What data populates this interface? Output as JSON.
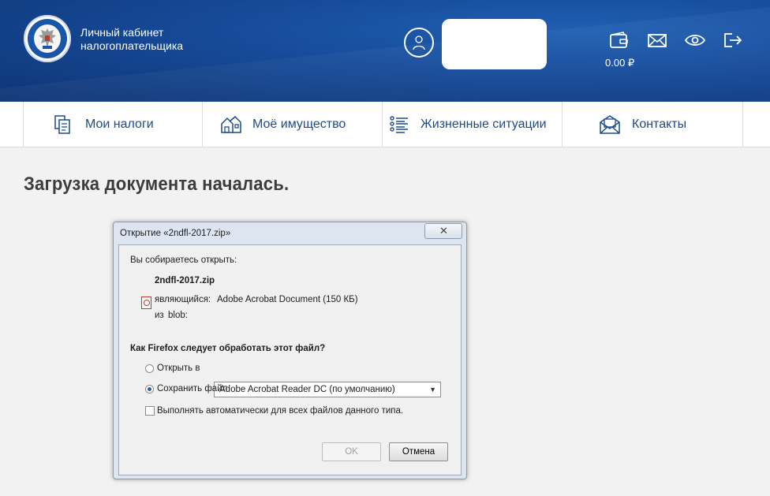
{
  "header": {
    "brand_line1": "Личный кабинет",
    "brand_line2": "налогоплательщика",
    "balance": "0.00 ₽",
    "icons": [
      "wallet-icon",
      "mail-icon",
      "eye-icon",
      "logout-icon"
    ]
  },
  "nav": {
    "items": [
      {
        "label": "Мои налоги",
        "icon": "documents-icon"
      },
      {
        "label": "Моё имущество",
        "icon": "houses-icon"
      },
      {
        "label": "Жизненные ситуации",
        "icon": "list-icon"
      },
      {
        "label": "Контакты",
        "icon": "envelope-icon"
      }
    ]
  },
  "page": {
    "title": "Загрузка документа началась."
  },
  "dialog": {
    "title": "Открытие «2ndfl-2017.zip»",
    "intro": "Вы собираетесь открыть:",
    "filename": "2ndfl-2017.zip",
    "type_label": "являющийся:",
    "type_value": "Adobe Acrobat Document (150 КБ)",
    "from_label": "из",
    "from_value": "blob:",
    "question": "Как Firefox следует обработать этот файл?",
    "open_with_label": "Открыть в",
    "open_with_value": "Adobe Acrobat Reader DC  (по умолчанию)",
    "save_label": "Сохранить файл",
    "selected_option": "save",
    "auto_label": "Выполнять автоматически для всех файлов данного типа.",
    "ok_label": "OK",
    "cancel_label": "Отмена"
  },
  "colors": {
    "header_blue": "#164a98",
    "nav_text": "#1c4a8c",
    "dialog_frame": "#dde6f0"
  }
}
